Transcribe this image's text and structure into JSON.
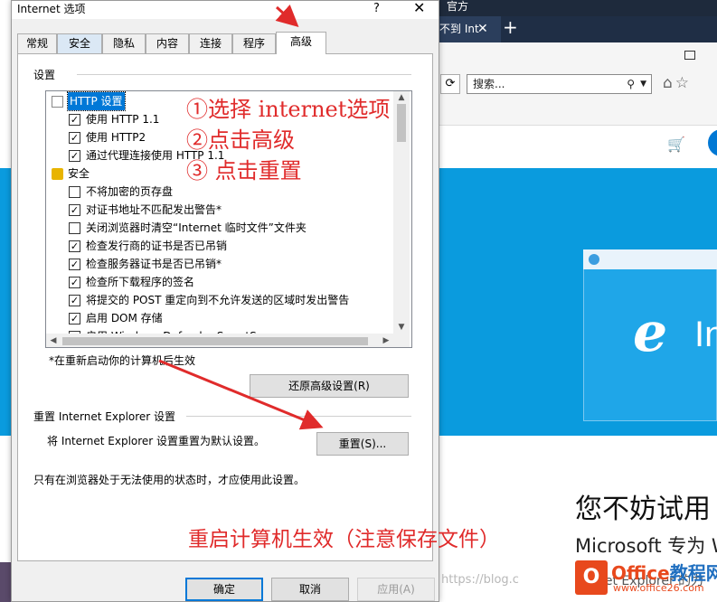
{
  "browser": {
    "topbar_title": "官方",
    "tab_label": "不到 Int",
    "tab_close": "✕",
    "tab_new": "+",
    "search_placeholder": "搜索...",
    "hero_logo_e": "e",
    "hero_logo_text": "In",
    "headline": "您不妨试用",
    "subheadline": "Microsoft 专为 W",
    "ie_link_text": "net Explorer 的力"
  },
  "dialog": {
    "title": "Internet 选项",
    "help": "?",
    "close": "✕",
    "tabs": [
      "常规",
      "安全",
      "隐私",
      "内容",
      "连接",
      "程序",
      "高级"
    ],
    "active_tab_index": 6,
    "settings_group_label": "设置",
    "settings_items": [
      {
        "type": "category",
        "icon": "document-icon",
        "label": "HTTP 设置",
        "selected": true
      },
      {
        "type": "checkbox",
        "checked": true,
        "label": "使用 HTTP 1.1"
      },
      {
        "type": "checkbox",
        "checked": true,
        "label": "使用 HTTP2"
      },
      {
        "type": "checkbox",
        "checked": true,
        "label": "通过代理连接使用 HTTP 1.1"
      },
      {
        "type": "category",
        "icon": "lock-icon",
        "label": "安全",
        "selected": false
      },
      {
        "type": "checkbox",
        "checked": false,
        "label": "不将加密的页存盘"
      },
      {
        "type": "checkbox",
        "checked": true,
        "label": "对证书地址不匹配发出警告*"
      },
      {
        "type": "checkbox",
        "checked": false,
        "label": "关闭浏览器时清空“Internet 临时文件”文件夹"
      },
      {
        "type": "checkbox",
        "checked": true,
        "label": "检查发行商的证书是否已吊销"
      },
      {
        "type": "checkbox",
        "checked": true,
        "label": "检查服务器证书是否已吊销*"
      },
      {
        "type": "checkbox",
        "checked": true,
        "label": "检查所下载程序的签名"
      },
      {
        "type": "checkbox",
        "checked": true,
        "label": "将提交的 POST 重定向到不允许发送的区域时发出警告"
      },
      {
        "type": "checkbox",
        "checked": true,
        "label": "启用 DOM 存储"
      },
      {
        "type": "checkbox",
        "checked": false,
        "label": "启用 Windows Defender SmartScreen"
      }
    ],
    "restart_note": "*在重新启动你的计算机后生效",
    "restore_button": "还原高级设置(R)",
    "reset_group_label": "重置 Internet Explorer 设置",
    "reset_desc": "将 Internet Explorer 设置重置为默认设置。",
    "reset_button": "重置(S)...",
    "reset_note": "只有在浏览器处于无法使用的状态时，才应使用此设置。",
    "ok_button": "确定",
    "cancel_button": "取消",
    "apply_button": "应用(A)"
  },
  "annotations": {
    "step1": "①选择 internet选项",
    "step2": "②点击高级",
    "step3": "③ 点击重置",
    "note": "重启计算机生效（注意保存文件）",
    "color": "#e02b2b"
  },
  "watermark": {
    "url_text": "https://blog.c",
    "logo_mark": "O",
    "logo_name_part1": "Office",
    "logo_name_part2": "教程网",
    "logo_url": "www.office26.com"
  }
}
